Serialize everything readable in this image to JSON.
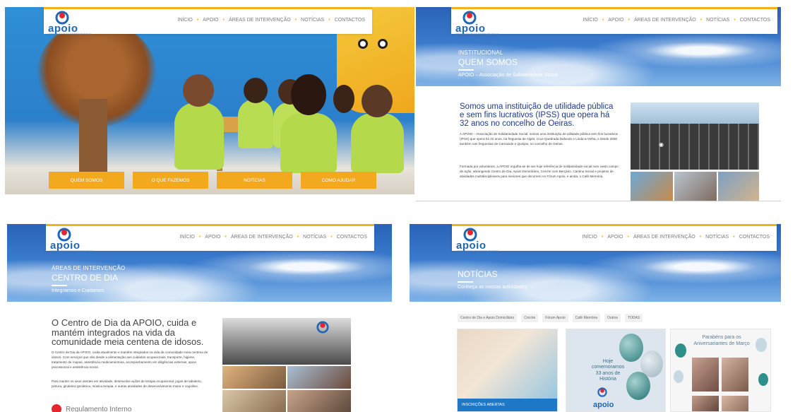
{
  "nav": {
    "brand": "apoio",
    "tagline": "ASSOCIAÇÃO DE SOLIDARIEDADE SOCIAL",
    "items": [
      "INÍCIO",
      "APOIO",
      "ÁREAS DE INTERVENÇÃO",
      "NOTÍCIAS",
      "CONTACTOS"
    ]
  },
  "home": {
    "buttons": [
      "QUEM SOMOS",
      "O QUE FAZEMOS",
      "NOTÍCIAS",
      "COMO AJUDAR"
    ]
  },
  "about": {
    "kicker": "INSTITUCIONAL",
    "title": "QUEM SOMOS",
    "subtitle": "APOIO – Associação de Solidariedade Social",
    "heading": "Somos uma instituição de utilidade pública e sem fins lucrativos  (IPSS) que opera há 32 anos no concelho de Oeiras.",
    "p1": "A APOIO – Associação de Solidariedade Social, somos uma instituição de utilidade pública sem fins lucrativos (IPSS) que opera há 32 anos, na freguesia de Algés, Cruz-Quebrada Dafundo e Linda-a-Velha, e desde 2008 também nas freguesias de Carnaxide e Queijas, no concelho de Oeiras.",
    "p2": "Formada por voluntários, a APOIO orgulha-se de ser hoje referência de solidariedade social num vasto campo de ação, abrangendo Centro de Dia, Apoio Domiciliário, Creche com Berçário, Cantina Social e projetos de atividades multidisciplinares para seniores que decorrem no Fórum Apoio, e ainda, o Café Memória."
  },
  "daycare": {
    "kicker": "ÁREAS DE INTERVENÇÃO",
    "title": "CENTRO DE DIA",
    "subtitle": "Integramos e Cuidamos",
    "heading": "O Centro de Dia da APOIO, cuida e mantém integrados na vida da comunidade meia centena de idosos.",
    "p1": "O Centro de Dia da APOIO, cuida atualmente e mantém integrados na vida da comunidade meia centena de idosos. Com serviços que vão desde a alimentação aos cuidados ocupacionais, transporte, higiene, tratamento de roupas, assistência medicamentosa, acompanhamento em diligências externas, apoio psicossocial e assistência social.",
    "p2": "Para manter os seus utentes em atividade, desenvolve ações de terapia ocupacional, jogos de tabuleiro, pintura, ginástica geriátrica, música terapia, e outras atividades de desenvolvimento motor e cognitivo.",
    "link": "Regulamento Interno"
  },
  "news": {
    "title": "NOTÍCIAS",
    "subtitle": "Conheça as nossas actividades",
    "filters": [
      "Centro de Dia e Apoio Domiciliário",
      "Creche",
      "Fórum Apoio",
      "Café Memória",
      "Outros",
      "TODAS"
    ],
    "card1_label": "INSCRIÇÕES ABERTAS",
    "card2_lines": [
      "Hoje",
      "comemoramos",
      "33 anos de",
      "História"
    ],
    "card3_title": "Parabéns para os Aniversariantes de Março"
  },
  "colors": {
    "accent": "#f2a91e",
    "brand_blue": "#1f66b3",
    "heading_blue": "#1e3a8a",
    "ribbon_blue": "#1e78c8"
  }
}
